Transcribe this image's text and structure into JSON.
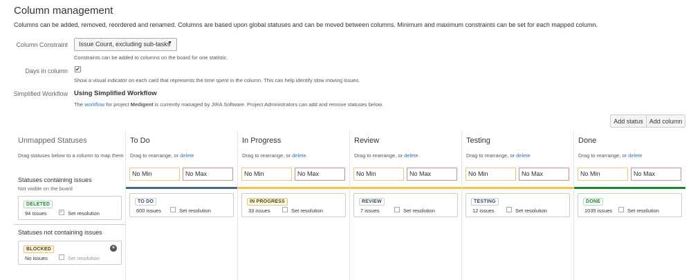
{
  "page": {
    "title": "Column management",
    "description": "Columns can be added, removed, reordered and renamed. Columns are based upon global statuses and can be moved between columns. Minimum and maximum constraints can be set for each mapped column."
  },
  "constraint": {
    "label": "Column Constraint",
    "selected": "Issue Count, excluding sub-tasks",
    "help": "Constraints can be added to columns on the board for one statistic."
  },
  "days_in_column": {
    "label": "Days in column",
    "checked": "✔",
    "help": "Show a visual indicator on each card that represents the time spent in the column. This can help identify slow moving issues."
  },
  "workflow": {
    "label": "Simplified Workflow",
    "value": "Using Simplified Workflow",
    "help_prefix": "The ",
    "help_link": "workflow",
    "help_mid": " for project ",
    "project": "Medigent",
    "help_suffix": " is currently managed by JIRA Software. Project Administrators can add and remove statuses below."
  },
  "toolbar": {
    "add_status": "Add status",
    "add_column": "Add column"
  },
  "unmapped": {
    "title": "Unmapped Statuses",
    "drag_help": "Drag statuses below to a column to map them",
    "containing_title": "Statuses containing issues",
    "containing_sub": "Not visible on the board",
    "not_containing_title": "Statuses not containing issues",
    "deleted": {
      "lozenge": "DELETED",
      "count": "94 issues",
      "resolution": "Set resolution",
      "checked": "✔"
    },
    "blocked": {
      "lozenge": "BLOCKED",
      "count": "No issues",
      "resolution": "Set resolution",
      "close": "×"
    }
  },
  "columns": [
    {
      "title": "To Do",
      "drag_prefix": "Drag to rearrange, or ",
      "delete": "delete",
      "min": "No Min",
      "max": "No Max",
      "bar_color": "#4a6785",
      "lozenge": "TO DO",
      "lozenge_style": "gray",
      "count": "600 issues",
      "resolution": "Set resolution"
    },
    {
      "title": "In Progress",
      "drag_prefix": "Drag to rearrange, or ",
      "delete": "delete",
      "min": "No Min",
      "max": "No Max",
      "bar_color": "#f6c342",
      "lozenge": "IN PROGRESS",
      "lozenge_style": "yellow",
      "count": "33 issues",
      "resolution": "Set resolution"
    },
    {
      "title": "Review",
      "drag_prefix": "Drag to rearrange, or ",
      "delete": "delete",
      "min": "No Min",
      "max": "No Max",
      "bar_color": "#f6c342",
      "lozenge": "REVIEW",
      "lozenge_style": "gray",
      "count": "7 issues",
      "resolution": "Set resolution"
    },
    {
      "title": "Testing",
      "drag_prefix": "Drag to rearrange, or ",
      "delete": "delete",
      "min": "No Min",
      "max": "No Max",
      "bar_color": "#f6c342",
      "lozenge": "TESTING",
      "lozenge_style": "gray",
      "count": "12 issues",
      "resolution": "Set resolution"
    },
    {
      "title": "Done",
      "drag_prefix": "Drag to rearrange, or ",
      "delete": "delete",
      "min": "No Min",
      "max": "No Max",
      "bar_color": "#14892c",
      "lozenge": "DONE",
      "lozenge_style": "green",
      "count": "1035 issues",
      "resolution": "Set resolution"
    }
  ]
}
